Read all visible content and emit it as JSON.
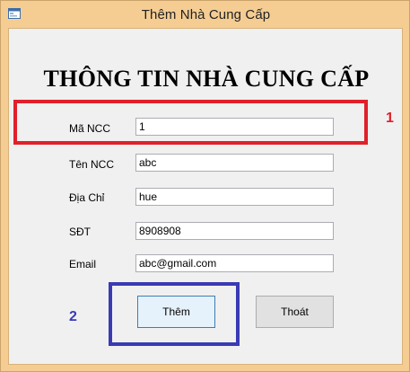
{
  "window": {
    "title": "Thêm  Nhà Cung Cấp"
  },
  "form": {
    "heading": "THÔNG TIN NHÀ CUNG CẤP",
    "fields": [
      {
        "label": "Mã NCC",
        "value": "1"
      },
      {
        "label": "Tên NCC",
        "value": "abc"
      },
      {
        "label": "Địa Chỉ",
        "value": "hue"
      },
      {
        "label": "SĐT",
        "value": "8908908"
      },
      {
        "label": "Email",
        "value": "abc@gmail.com"
      }
    ],
    "add_label": "Thêm",
    "exit_label": "Thoát"
  },
  "annotations": {
    "marker_1": "1",
    "marker_2": "2",
    "red_color": "#e0202a",
    "blue_color": "#3a3ab5"
  }
}
